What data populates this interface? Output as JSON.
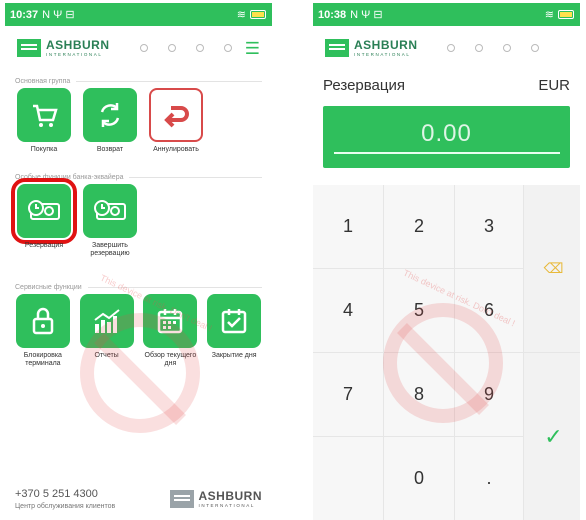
{
  "left": {
    "statusbar": {
      "time": "10:37",
      "icons": "N Ψ ⊟"
    },
    "logo": {
      "name": "ASHBURN",
      "sub": "INTERNATIONAL"
    },
    "menu_icon": "☰",
    "sections": [
      {
        "title": "Основная группа"
      },
      {
        "title": "Особые функции банка-эквайера"
      },
      {
        "title": "Сервисные функции"
      }
    ],
    "tiles": {
      "purchase": "Покупка",
      "refund": "Возврат",
      "cancel": "Аннулировать",
      "reservation": "Резервация",
      "complete_reservation": "Завершить резервацию",
      "lock_terminal": "Блокировка терминала",
      "reports": "Отчеты",
      "day_overview": "Обзор текущего дня",
      "close_day": "Закрытие дня"
    },
    "footer": {
      "phone": "+370 5 251 4300",
      "label": "Центр обслуживания клиентов"
    },
    "watermark": "This device at risk. Don't deal !"
  },
  "right": {
    "statusbar": {
      "time": "10:38",
      "icons": "N Ψ ⊟"
    },
    "logo": {
      "name": "ASHBURN",
      "sub": "INTERNATIONAL"
    },
    "title": "Резервация",
    "currency": "EUR",
    "amount": "0.00",
    "keys": [
      "1",
      "2",
      "3",
      "4",
      "5",
      "6",
      "7",
      "8",
      "9",
      "0",
      "."
    ],
    "backspace_icon": "⌫",
    "ok_icon": "✓",
    "watermark": "This device at risk. Don't deal !"
  }
}
